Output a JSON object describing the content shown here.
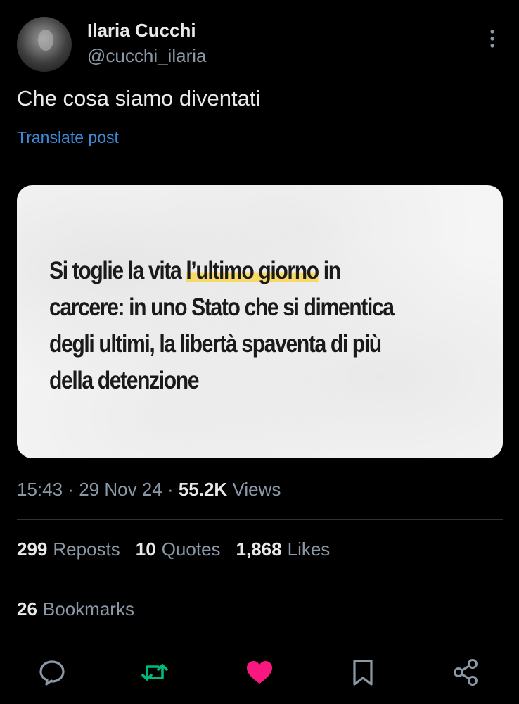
{
  "author": {
    "display_name": "Ilaria Cucchi",
    "handle": "@cucchi_ilaria"
  },
  "post": {
    "text": "Che cosa siamo diventati",
    "translate_label": "Translate post"
  },
  "media": {
    "headline_before": "Si toglie la vita ",
    "headline_highlight": "l’ultimo giorno",
    "headline_line1_end": " in",
    "headline_line2": "carcere: in uno Stato che si dimentica",
    "headline_line3": "degli ultimi, la libertà spaventa di più",
    "headline_line4": "della detenzione"
  },
  "meta": {
    "time": "15:43",
    "separator": " · ",
    "date": "29 Nov 24",
    "views_count": "55.2K",
    "views_label": "Views"
  },
  "stats": {
    "reposts_count": "299",
    "reposts_label": "Reposts",
    "quotes_count": "10",
    "quotes_label": "Quotes",
    "likes_count": "1,868",
    "likes_label": "Likes",
    "bookmarks_count": "26",
    "bookmarks_label": "Bookmarks"
  },
  "actions": {
    "reply_icon": "reply-icon",
    "repost_icon": "repost-icon",
    "like_icon": "like-icon",
    "bookmark_icon": "bookmark-icon",
    "share_icon": "share-icon"
  },
  "colors": {
    "background": "#000000",
    "primary_text": "#e7e9ea",
    "secondary_text": "#8b98a5",
    "link": "#3b8ad9",
    "repost_active": "#00ba7c",
    "like_active": "#f91880",
    "highlight": "#f7d96a"
  }
}
